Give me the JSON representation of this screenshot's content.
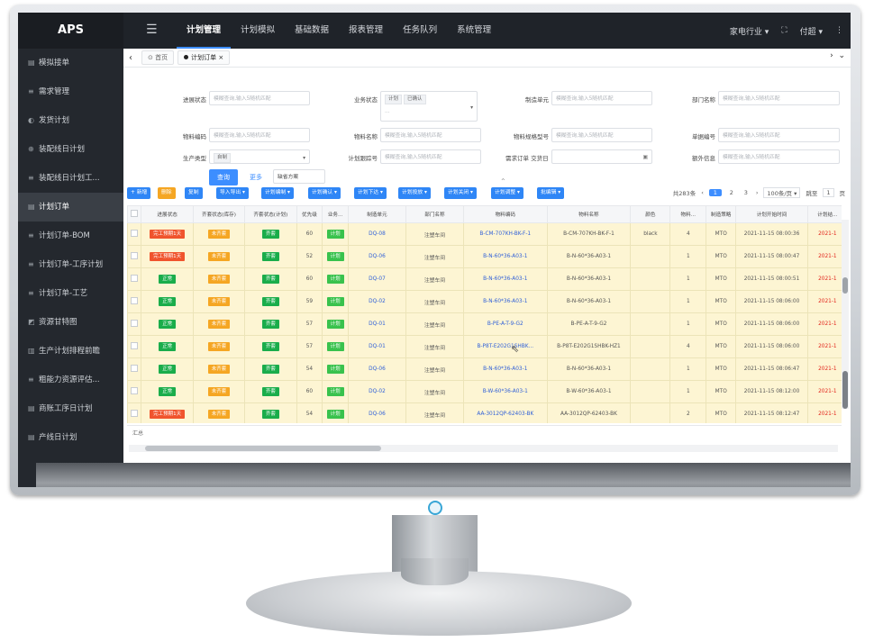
{
  "app": {
    "logo": "APS"
  },
  "topbar": {
    "nav": [
      "计划管理",
      "计划模拟",
      "基础数据",
      "报表管理",
      "任务队列",
      "系统管理"
    ],
    "active_index": 0,
    "industry": "家电行业 ▾",
    "user": "付超 ▾",
    "more": "⋮"
  },
  "sidebar": {
    "items": [
      {
        "icon": "▤",
        "label": "模拟接单"
      },
      {
        "icon": "≡",
        "label": "需求管理"
      },
      {
        "icon": "◐",
        "label": "发货计划"
      },
      {
        "icon": "⊕",
        "label": "装配线日计划"
      },
      {
        "icon": "≡",
        "label": "装配线日计划工..."
      },
      {
        "icon": "▤",
        "label": "计划订单"
      },
      {
        "icon": "≡",
        "label": "计划订单-BOM"
      },
      {
        "icon": "≡",
        "label": "计划订单-工序计划"
      },
      {
        "icon": "≡",
        "label": "计划订单-工艺"
      },
      {
        "icon": "◩",
        "label": "资源甘特图"
      },
      {
        "icon": "▥",
        "label": "生产计划排程前瞻"
      },
      {
        "icon": "≡",
        "label": "粗能力资源评估..."
      },
      {
        "icon": "▤",
        "label": "商账工序日计划"
      },
      {
        "icon": "▤",
        "label": "产线日计划"
      }
    ],
    "active_index": 5
  },
  "tabs": {
    "items": [
      "首页",
      "计划订单"
    ],
    "active_index": 1
  },
  "filters": {
    "fields": [
      {
        "label": "进展状态",
        "placeholder": "模糊查询,输入5随机匹配"
      },
      {
        "label": "业务状态",
        "chips": [
          "计划",
          "已确认"
        ],
        "extra": "..."
      },
      {
        "label": "制造单元",
        "placeholder": "模糊查询,输入5随机匹配"
      },
      {
        "label": "部门名称",
        "placeholder": "模糊查询,输入5随机匹配"
      },
      {
        "label": "物料编码",
        "placeholder": "模糊查询,输入5随机匹配"
      },
      {
        "label": "物料名称",
        "placeholder": "模糊查询,输入5随机匹配"
      },
      {
        "label": "物料规格型号",
        "placeholder": "模糊查询,输入5随机匹配"
      },
      {
        "label": "单据编号",
        "placeholder": "模糊查询,输入5随机匹配"
      },
      {
        "label": "生产类型",
        "chips": [
          "自制"
        ]
      },
      {
        "label": "计划跟踪号",
        "placeholder": "模糊查询,输入5随机匹配"
      },
      {
        "label": "需求订单 交货日期",
        "placeholder": ""
      },
      {
        "label": "额外信息",
        "placeholder": "模糊查询,输入5随机匹配"
      }
    ],
    "query_button": "查询",
    "more_link": "更多",
    "scheme_select": "缺省方案"
  },
  "toolbar": {
    "buttons": [
      {
        "label": "+ 新增",
        "color": "#2f86f6"
      },
      {
        "label": "删除",
        "color": "#f5a623"
      },
      {
        "label": "复制",
        "color": "#2f86f6"
      },
      {
        "label": "导入导出 ▾",
        "color": "#2f86f6"
      },
      {
        "label": "计划编制 ▾",
        "color": "#2f86f6"
      },
      {
        "label": "计划确认 ▾",
        "color": "#2f86f6"
      },
      {
        "label": "计划下达 ▾",
        "color": "#2f86f6"
      },
      {
        "label": "计划投放 ▾",
        "color": "#2f86f6"
      },
      {
        "label": "计划关闭 ▾",
        "color": "#2f86f6"
      },
      {
        "label": "计划调整 ▾",
        "color": "#2f86f6"
      },
      {
        "label": "批编辑 ▾",
        "color": "#2f86f6"
      }
    ],
    "pager": {
      "total": "共283条",
      "pages": [
        "1",
        "2",
        "3"
      ],
      "current": "1",
      "page_size": "100条/页 ▾",
      "jump_label": "跳至",
      "jump_value": "1",
      "page_suffix": "页"
    }
  },
  "table": {
    "columns": [
      "进展状态",
      "齐套状态(库存)",
      "齐套状态(计划)",
      "优先级",
      "业务...",
      "制造单元",
      "部门名称",
      "物料编码",
      "物料名称",
      "颜色",
      "物料...",
      "制造策略",
      "计划开始时间",
      "计划结..."
    ],
    "rows": [
      [
        "完工预期1天",
        "未齐套",
        "齐套",
        "60",
        "计划",
        "DQ-08",
        "注塑车间",
        "B-CM-707KH-BK-F-1",
        "B-CM-707KH-BK-F-1",
        "black",
        "4",
        "MTO",
        "2021-11-15 08:00:36",
        "2021-1"
      ],
      [
        "完工预期1天",
        "未齐套",
        "齐套",
        "52",
        "计划",
        "DQ-06",
        "注塑车间",
        "B-N-60*36-A03-1",
        "B-N-60*36-A03-1",
        "",
        "1",
        "MTO",
        "2021-11-15 08:00:47",
        "2021-1"
      ],
      [
        "正常",
        "未齐套",
        "齐套",
        "60",
        "计划",
        "DQ-07",
        "注塑车间",
        "B-N-60*36-A03-1",
        "B-N-60*36-A03-1",
        "",
        "1",
        "MTO",
        "2021-11-15 08:00:51",
        "2021-1"
      ],
      [
        "正常",
        "未齐套",
        "齐套",
        "59",
        "计划",
        "DQ-02",
        "注塑车间",
        "B-N-60*36-A03-1",
        "B-N-60*36-A03-1",
        "",
        "1",
        "MTO",
        "2021-11-15 08:06:00",
        "2021-1"
      ],
      [
        "正常",
        "未齐套",
        "齐套",
        "57",
        "计划",
        "DQ-01",
        "注塑车间",
        "B-PE-A-T-9-G2",
        "B-PE-A-T-9-G2",
        "",
        "1",
        "MTO",
        "2021-11-15 08:06:00",
        "2021-1"
      ],
      [
        "正常",
        "未齐套",
        "齐套",
        "57",
        "计划",
        "DQ-01",
        "注塑车间",
        "B-P8T-E202G1SHBK...",
        "B-P8T-E202G1SHBK-HZ1",
        "",
        "4",
        "MTO",
        "2021-11-15 08:06:00",
        "2021-1"
      ],
      [
        "正常",
        "未齐套",
        "齐套",
        "54",
        "计划",
        "DQ-06",
        "注塑车间",
        "B-N-60*36-A03-1",
        "B-N-60*36-A03-1",
        "",
        "1",
        "MTO",
        "2021-11-15 08:06:47",
        "2021-1"
      ],
      [
        "正常",
        "未齐套",
        "齐套",
        "60",
        "计划",
        "DQ-02",
        "注塑车间",
        "B-W-60*36-A03-1",
        "B-W-60*36-A03-1",
        "",
        "1",
        "MTO",
        "2021-11-15 08:12:00",
        "2021-1"
      ],
      [
        "完工预期1天",
        "未齐套",
        "齐套",
        "54",
        "计划",
        "DQ-06",
        "注塑车间",
        "AA-3012QP-62403-BK",
        "AA-3012QP-62403-BK",
        "",
        "2",
        "MTO",
        "2021-11-15 08:12:47",
        "2021-1"
      ],
      [
        "正常",
        "未齐套",
        "齐套",
        "62",
        "计划",
        "DQ-07",
        "注塑车间",
        "AA-3012QP-62403-BK",
        "AA-3012QP-62403-BK",
        "",
        "2",
        "MTO",
        "2021-11-15 08:12:51",
        "2021-1"
      ]
    ],
    "summary_label": "汇总"
  },
  "colors": {
    "status_late": "#f0542d",
    "status_normal": "#1aad4b",
    "stock_missing": "#f5a623",
    "plan_complete": "#1aad4b",
    "business_plan": "#39c24d",
    "accent": "#3d8eff"
  }
}
